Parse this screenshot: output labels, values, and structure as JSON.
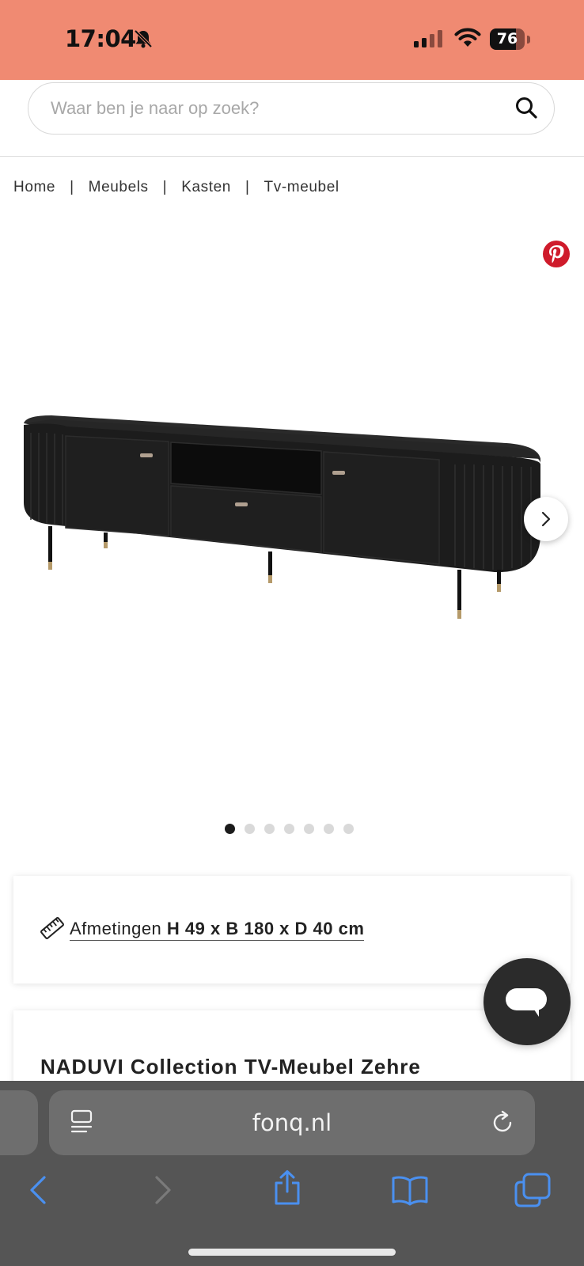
{
  "status_bar": {
    "time": "17:04",
    "battery_level": "76",
    "bar_color": "#f08a72"
  },
  "search": {
    "placeholder": "Waar ben je naar op zoek?"
  },
  "breadcrumb": {
    "items": [
      "Home",
      "Meubels",
      "Kasten",
      "Tv-meubel"
    ],
    "separator": "|"
  },
  "gallery": {
    "image_count": 7,
    "active_index": 0
  },
  "dimensions": {
    "label": "Afmetingen",
    "value": "H 49 x B 180 x D 40 cm"
  },
  "product": {
    "title": "NADUVI Collection TV-Meubel Zehre"
  },
  "browser": {
    "url": "fonq.nl"
  },
  "icons": {
    "bell": "bell-slash-icon",
    "pinterest": "pinterest-icon",
    "ruler": "ruler-icon",
    "chat": "chat-bubble-icon",
    "reader": "reader-icon",
    "reload": "reload-icon"
  },
  "colors": {
    "accent_pinterest": "#cf1b2b",
    "chat_button": "#2b2b2b",
    "safari_bar": "#555555",
    "safari_icons": "#4a90f0"
  }
}
